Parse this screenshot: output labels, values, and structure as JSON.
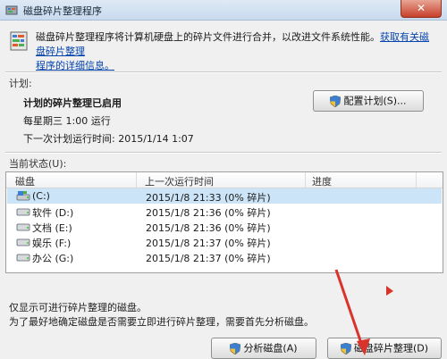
{
  "window": {
    "title": "磁盘碎片整理程序",
    "close_label": "✕"
  },
  "intro": {
    "text": "磁盘碎片整理程序将计算机硬盘上的碎片文件进行合并，以改进文件系统性能。",
    "link1": "获取有关磁盘碎片整理",
    "link2": "程序的详细信息。"
  },
  "schedule": {
    "section_label": "计划:",
    "title": "计划的碎片整理已启用",
    "line1": "每星期三 1:00 运行",
    "line2": "下一次计划运行时间: 2015/1/14 1:07",
    "configure_button": "配置计划(S)..."
  },
  "status": {
    "section_label": "当前状态(U):",
    "columns": [
      "磁盘",
      "上一次运行时间",
      "进度"
    ],
    "rows": [
      {
        "name": "(C:)",
        "last": "2015/1/8 21:33 (0% 碎片)",
        "icon": "system-drive-icon",
        "selected": true
      },
      {
        "name": "软件 (D:)",
        "last": "2015/1/8 21:36 (0% 碎片)",
        "icon": "drive-icon",
        "selected": false
      },
      {
        "name": "文档 (E:)",
        "last": "2015/1/8 21:36 (0% 碎片)",
        "icon": "drive-icon",
        "selected": false
      },
      {
        "name": "娱乐 (F:)",
        "last": "2015/1/8 21:37 (0% 碎片)",
        "icon": "drive-icon",
        "selected": false
      },
      {
        "name": "办公 (G:)",
        "last": "2015/1/8 21:37 (0% 碎片)",
        "icon": "drive-icon",
        "selected": false
      }
    ]
  },
  "notes": {
    "line1": "仅显示可进行碎片整理的磁盘。",
    "line2": "为了最好地确定磁盘是否需要立即进行碎片整理，需要首先分析磁盘。"
  },
  "actions": {
    "analyze_button": "分析磁盘(A)",
    "defrag_button": "磁盘碎片整理(D)"
  },
  "colors": {
    "link": "#0645ad",
    "selection": "#cce4f7",
    "annotation_arrow": "#d9342b"
  }
}
